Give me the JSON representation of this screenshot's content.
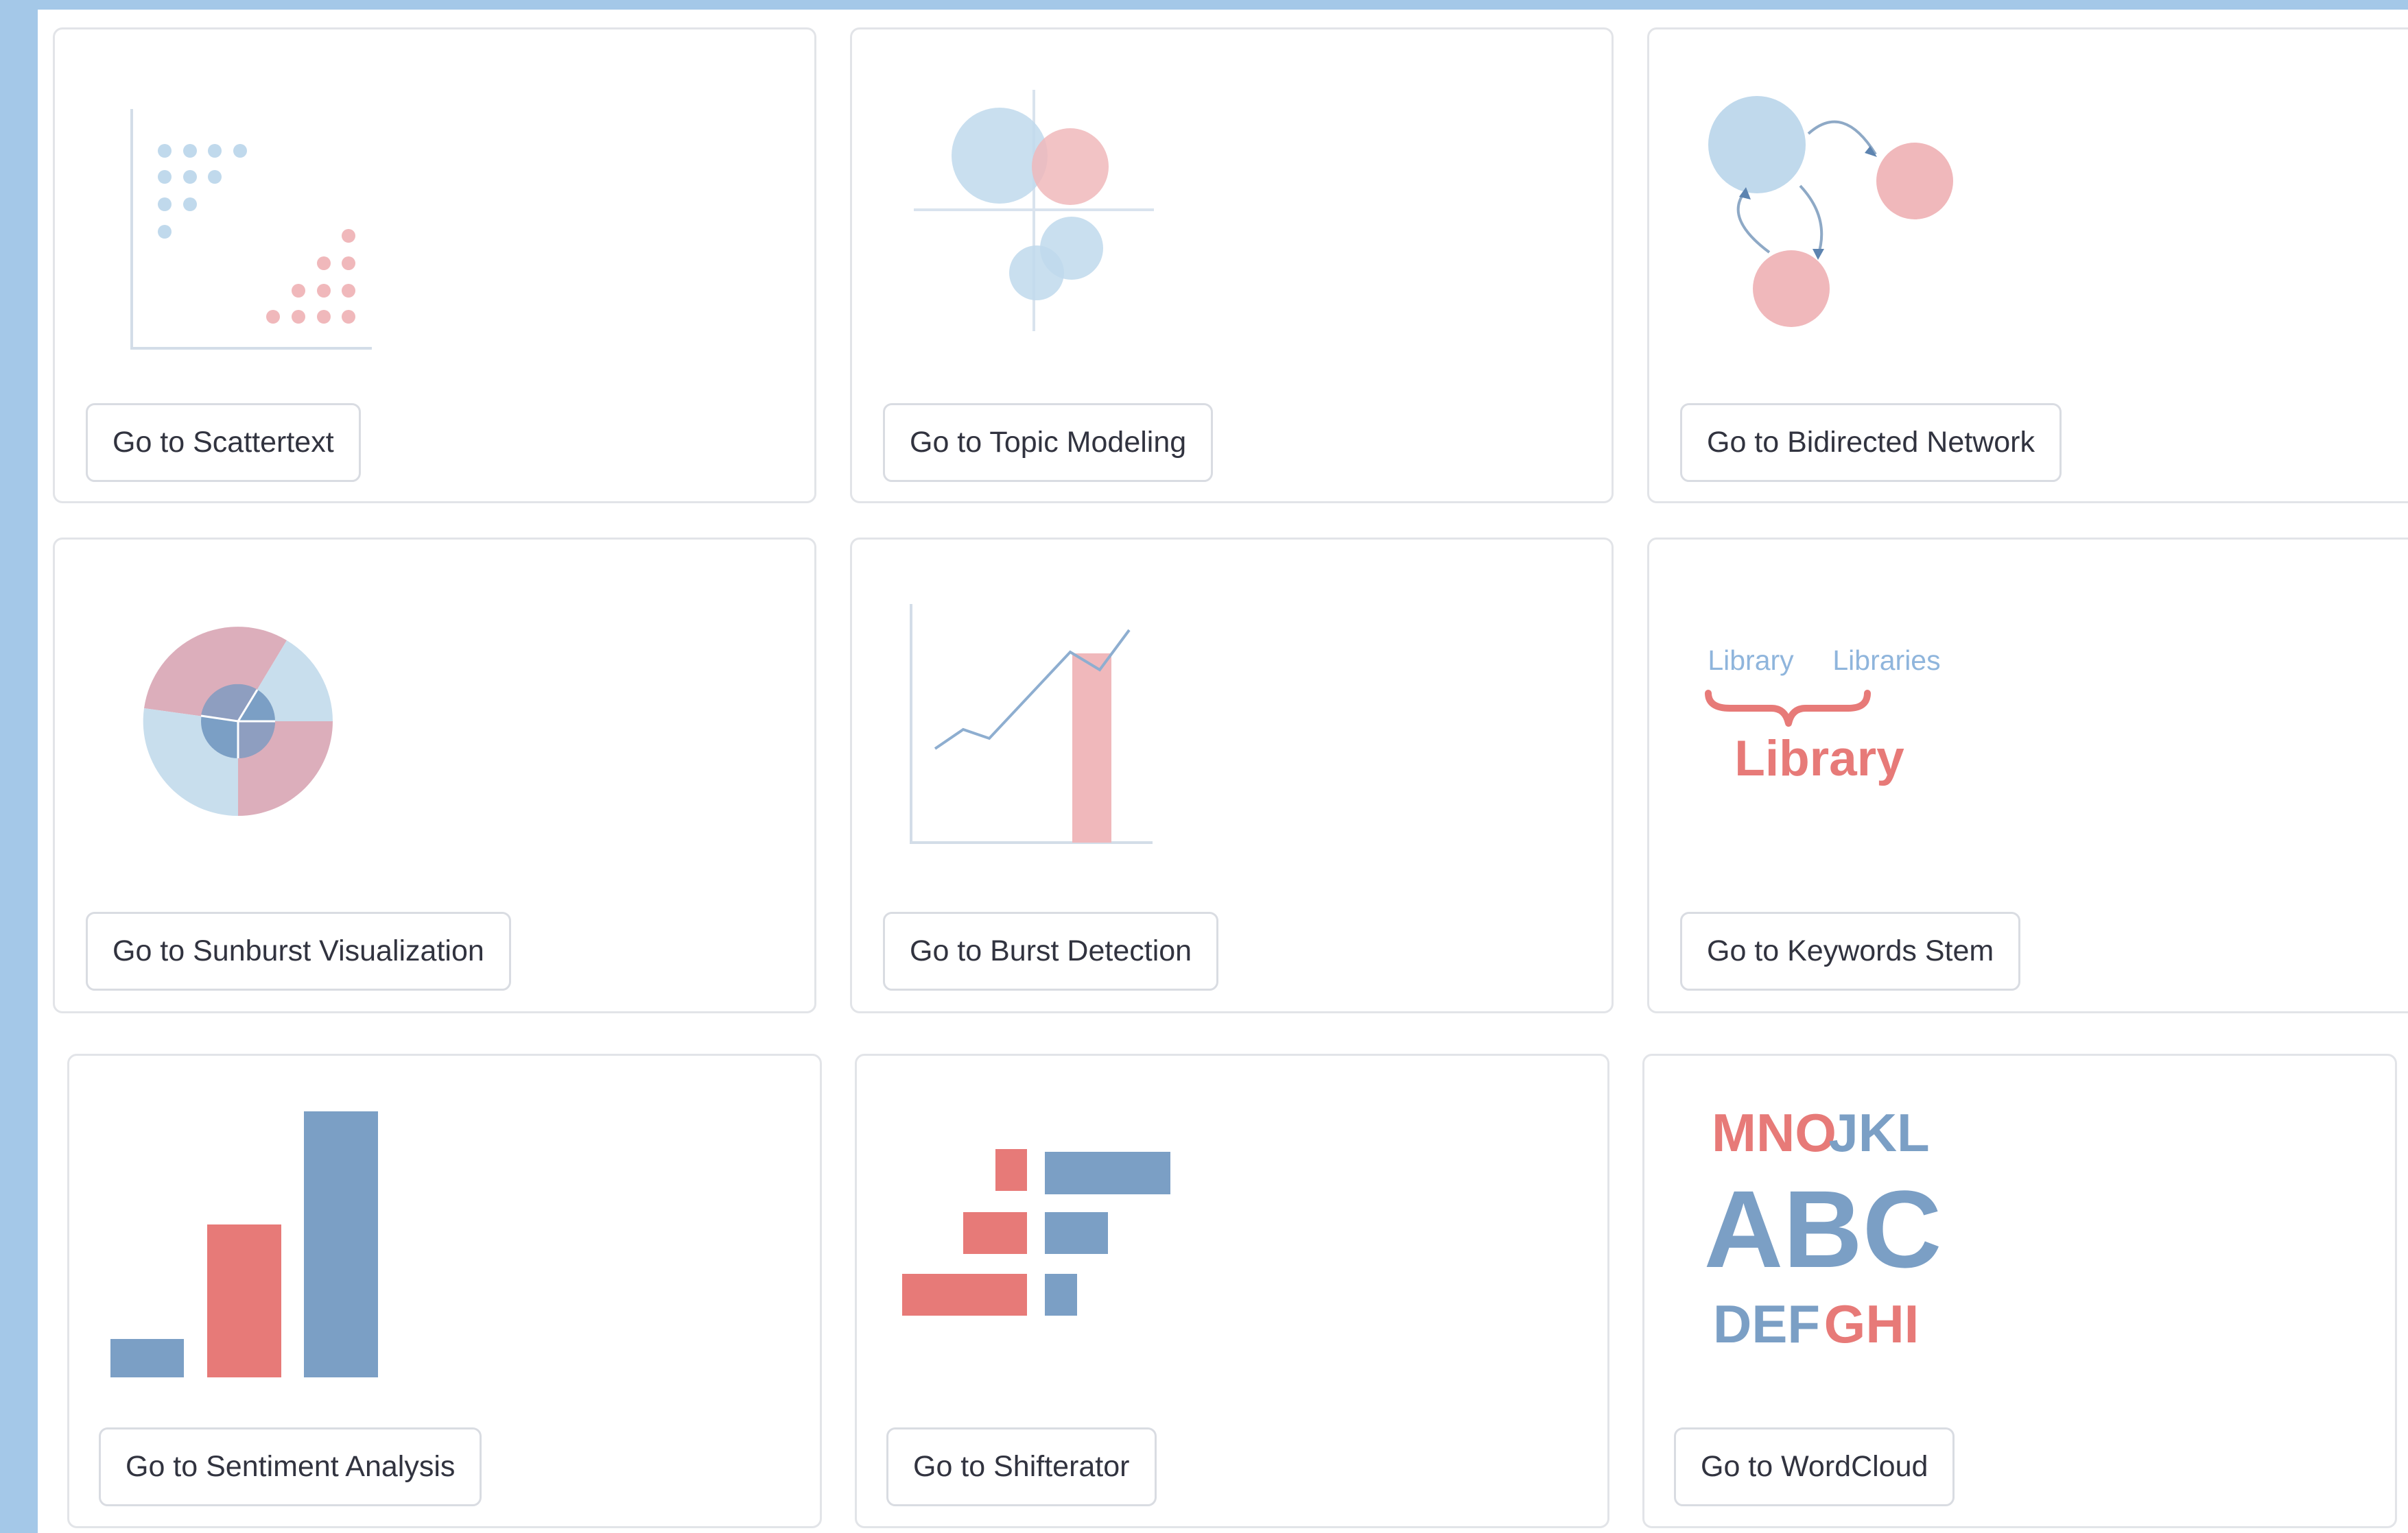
{
  "cards": [
    {
      "id": "scattertext",
      "button_label": "Go to Scattertext"
    },
    {
      "id": "topic-modeling",
      "button_label": "Go to Topic Modeling"
    },
    {
      "id": "bidirected-network",
      "button_label": "Go to Bidirected Network"
    },
    {
      "id": "sunburst",
      "button_label": "Go to Sunburst Visualization"
    },
    {
      "id": "burst-detection",
      "button_label": "Go to Burst Detection"
    },
    {
      "id": "keywords-stem",
      "button_label": "Go to Keywords Stem",
      "icon_words": {
        "left": "Library",
        "right": "Libraries",
        "stem": "Library"
      }
    },
    {
      "id": "sentiment-analysis",
      "button_label": "Go to Sentiment Analysis"
    },
    {
      "id": "shifterator",
      "button_label": "Go to Shifterator"
    },
    {
      "id": "wordcloud",
      "button_label": "Go to WordCloud",
      "icon_words": {
        "top_left": "MNO",
        "top_right": "JKL",
        "center": "ABC",
        "bottom_left": "DEF",
        "bottom_right": "GHI"
      }
    }
  ],
  "colors": {
    "light_blue": "#c0d9ec",
    "light_red": "#f0b8bb",
    "blue": "#7b9fc5",
    "red": "#e77a78",
    "page_border": "#a4c8e8"
  }
}
